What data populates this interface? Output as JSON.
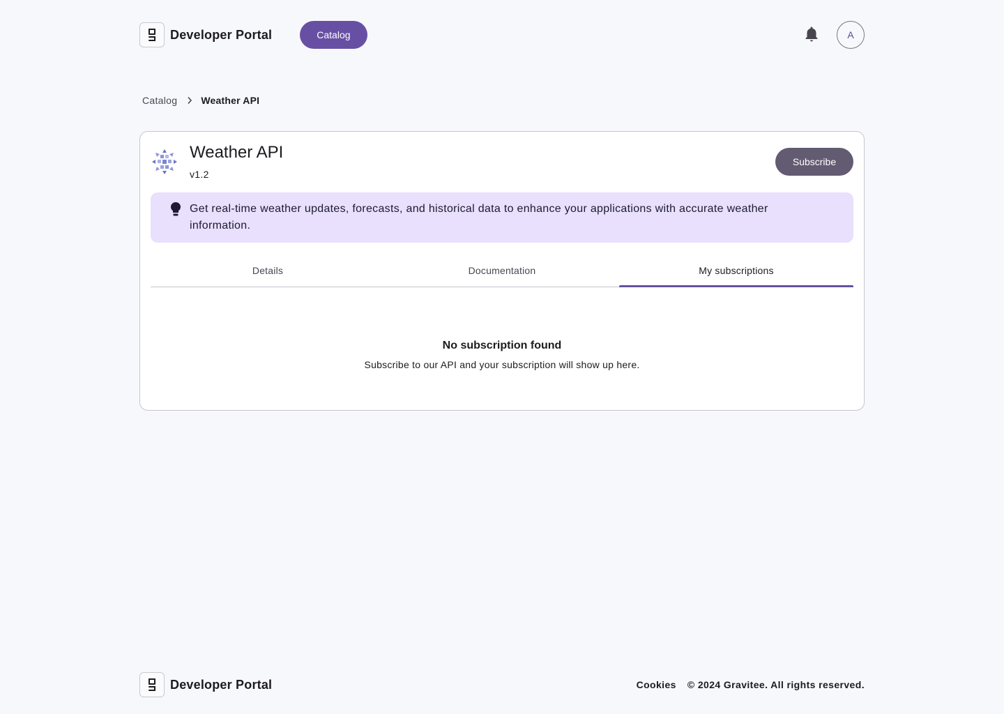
{
  "header": {
    "brand_name": "Developer Portal",
    "nav_catalog": "Catalog",
    "avatar_initial": "A"
  },
  "breadcrumb": {
    "parent": "Catalog",
    "current": "Weather API"
  },
  "api": {
    "title": "Weather API",
    "version": "v1.2",
    "subscribe_label": "Subscribe",
    "description": "Get real-time weather updates, forecasts, and historical data to enhance your applications with accurate weather information."
  },
  "tabs": [
    {
      "label": "Details",
      "active": false
    },
    {
      "label": "Documentation",
      "active": false
    },
    {
      "label": "My subscriptions",
      "active": true
    }
  ],
  "empty_state": {
    "title": "No subscription found",
    "subtitle": "Subscribe to our API and your subscription will show up here."
  },
  "footer": {
    "brand_name": "Developer Portal",
    "cookies": "Cookies",
    "copyright": "© 2024 Gravitee. All rights reserved."
  },
  "colors": {
    "primary": "#6750a4",
    "subscribe_bg": "#625b71",
    "banner_bg": "#e8e0fc",
    "page_bg": "#f7f8fc"
  },
  "icons": {
    "logo": "gravitee-logo-icon",
    "notifications": "bell-icon",
    "breadcrumb_separator": "chevron-right-icon",
    "api": "api-pattern-icon",
    "info": "lightbulb-icon"
  }
}
